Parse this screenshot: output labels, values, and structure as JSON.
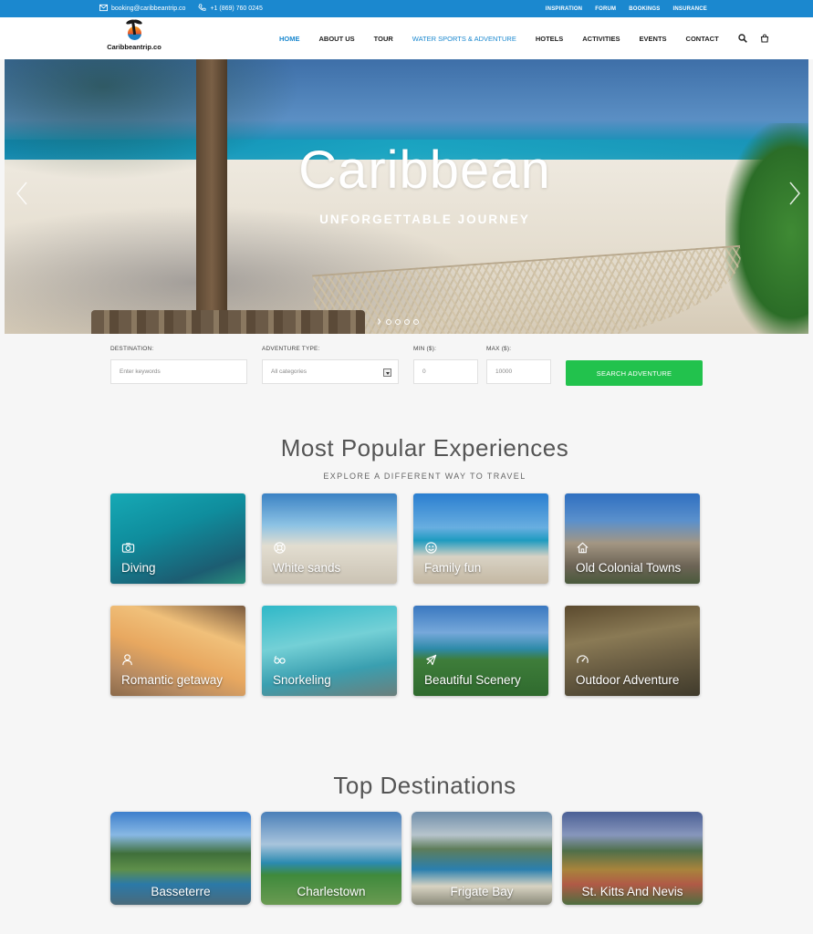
{
  "topbar": {
    "email": "booking@caribbeantrip.co",
    "phone": "+1 (869) 760 0245",
    "links": [
      "INSPIRATION",
      "FORUM",
      "BOOKINGS",
      "INSURANCE"
    ]
  },
  "header": {
    "logo_text": "Caribbeantrip.co",
    "nav": [
      "HOME",
      "ABOUT US",
      "TOUR",
      "WATER SPORTS & ADVENTURE",
      "HOTELS",
      "ACTIVITIES",
      "EVENTS",
      "CONTACT"
    ],
    "active_item": "HOME"
  },
  "hero": {
    "title": "Caribbean",
    "subtitle": "UNFORGETTABLE JOURNEY",
    "slides": 5
  },
  "search": {
    "destination_label": "DESTINATION:",
    "destination_placeholder": "Enter keywords",
    "type_label": "ADVENTURE TYPE:",
    "type_value": "All categories",
    "min_label": "MIN ($):",
    "min_value": "0",
    "max_label": "MAX ($):",
    "max_value": "10000",
    "button": "SEARCH ADVENTURE"
  },
  "experiences": {
    "title": "Most Popular Experiences",
    "subtitle": "EXPLORE A DIFFERENT WAY TO TRAVEL",
    "items": [
      {
        "label": "Diving",
        "icon": "camera-icon"
      },
      {
        "label": "White sands",
        "icon": "lifebuoy-icon"
      },
      {
        "label": "Family fun",
        "icon": "smiley-icon"
      },
      {
        "label": "Old Colonial Towns",
        "icon": "home-icon"
      },
      {
        "label": "Romantic getaway",
        "icon": "couple-icon"
      },
      {
        "label": "Snorkeling",
        "icon": "goggles-icon"
      },
      {
        "label": "Beautiful Scenery",
        "icon": "plane-icon"
      },
      {
        "label": "Outdoor Adventure",
        "icon": "gauge-icon"
      }
    ]
  },
  "destinations": {
    "title": "Top Destinations",
    "items": [
      {
        "label": "Basseterre"
      },
      {
        "label": "Charlestown"
      },
      {
        "label": "Frigate Bay"
      },
      {
        "label": "St. Kitts And Nevis"
      }
    ]
  },
  "colors": {
    "brand_blue": "#1b88cf",
    "search_green": "#22c24d"
  }
}
